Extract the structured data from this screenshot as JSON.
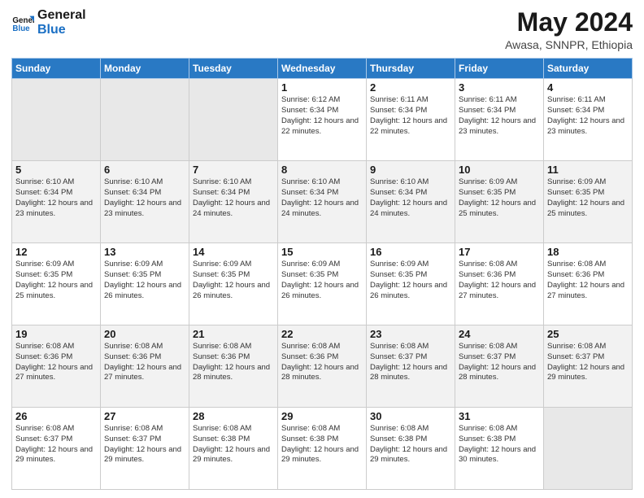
{
  "header": {
    "logo_line1": "General",
    "logo_line2": "Blue",
    "month_title": "May 2024",
    "location": "Awasa, SNNPR, Ethiopia"
  },
  "weekdays": [
    "Sunday",
    "Monday",
    "Tuesday",
    "Wednesday",
    "Thursday",
    "Friday",
    "Saturday"
  ],
  "weeks": [
    [
      {
        "day": "",
        "info": ""
      },
      {
        "day": "",
        "info": ""
      },
      {
        "day": "",
        "info": ""
      },
      {
        "day": "1",
        "info": "Sunrise: 6:12 AM\nSunset: 6:34 PM\nDaylight: 12 hours and 22 minutes."
      },
      {
        "day": "2",
        "info": "Sunrise: 6:11 AM\nSunset: 6:34 PM\nDaylight: 12 hours and 22 minutes."
      },
      {
        "day": "3",
        "info": "Sunrise: 6:11 AM\nSunset: 6:34 PM\nDaylight: 12 hours and 23 minutes."
      },
      {
        "day": "4",
        "info": "Sunrise: 6:11 AM\nSunset: 6:34 PM\nDaylight: 12 hours and 23 minutes."
      }
    ],
    [
      {
        "day": "5",
        "info": "Sunrise: 6:10 AM\nSunset: 6:34 PM\nDaylight: 12 hours and 23 minutes."
      },
      {
        "day": "6",
        "info": "Sunrise: 6:10 AM\nSunset: 6:34 PM\nDaylight: 12 hours and 23 minutes."
      },
      {
        "day": "7",
        "info": "Sunrise: 6:10 AM\nSunset: 6:34 PM\nDaylight: 12 hours and 24 minutes."
      },
      {
        "day": "8",
        "info": "Sunrise: 6:10 AM\nSunset: 6:34 PM\nDaylight: 12 hours and 24 minutes."
      },
      {
        "day": "9",
        "info": "Sunrise: 6:10 AM\nSunset: 6:34 PM\nDaylight: 12 hours and 24 minutes."
      },
      {
        "day": "10",
        "info": "Sunrise: 6:09 AM\nSunset: 6:35 PM\nDaylight: 12 hours and 25 minutes."
      },
      {
        "day": "11",
        "info": "Sunrise: 6:09 AM\nSunset: 6:35 PM\nDaylight: 12 hours and 25 minutes."
      }
    ],
    [
      {
        "day": "12",
        "info": "Sunrise: 6:09 AM\nSunset: 6:35 PM\nDaylight: 12 hours and 25 minutes."
      },
      {
        "day": "13",
        "info": "Sunrise: 6:09 AM\nSunset: 6:35 PM\nDaylight: 12 hours and 26 minutes."
      },
      {
        "day": "14",
        "info": "Sunrise: 6:09 AM\nSunset: 6:35 PM\nDaylight: 12 hours and 26 minutes."
      },
      {
        "day": "15",
        "info": "Sunrise: 6:09 AM\nSunset: 6:35 PM\nDaylight: 12 hours and 26 minutes."
      },
      {
        "day": "16",
        "info": "Sunrise: 6:09 AM\nSunset: 6:35 PM\nDaylight: 12 hours and 26 minutes."
      },
      {
        "day": "17",
        "info": "Sunrise: 6:08 AM\nSunset: 6:36 PM\nDaylight: 12 hours and 27 minutes."
      },
      {
        "day": "18",
        "info": "Sunrise: 6:08 AM\nSunset: 6:36 PM\nDaylight: 12 hours and 27 minutes."
      }
    ],
    [
      {
        "day": "19",
        "info": "Sunrise: 6:08 AM\nSunset: 6:36 PM\nDaylight: 12 hours and 27 minutes."
      },
      {
        "day": "20",
        "info": "Sunrise: 6:08 AM\nSunset: 6:36 PM\nDaylight: 12 hours and 27 minutes."
      },
      {
        "day": "21",
        "info": "Sunrise: 6:08 AM\nSunset: 6:36 PM\nDaylight: 12 hours and 28 minutes."
      },
      {
        "day": "22",
        "info": "Sunrise: 6:08 AM\nSunset: 6:36 PM\nDaylight: 12 hours and 28 minutes."
      },
      {
        "day": "23",
        "info": "Sunrise: 6:08 AM\nSunset: 6:37 PM\nDaylight: 12 hours and 28 minutes."
      },
      {
        "day": "24",
        "info": "Sunrise: 6:08 AM\nSunset: 6:37 PM\nDaylight: 12 hours and 28 minutes."
      },
      {
        "day": "25",
        "info": "Sunrise: 6:08 AM\nSunset: 6:37 PM\nDaylight: 12 hours and 29 minutes."
      }
    ],
    [
      {
        "day": "26",
        "info": "Sunrise: 6:08 AM\nSunset: 6:37 PM\nDaylight: 12 hours and 29 minutes."
      },
      {
        "day": "27",
        "info": "Sunrise: 6:08 AM\nSunset: 6:37 PM\nDaylight: 12 hours and 29 minutes."
      },
      {
        "day": "28",
        "info": "Sunrise: 6:08 AM\nSunset: 6:38 PM\nDaylight: 12 hours and 29 minutes."
      },
      {
        "day": "29",
        "info": "Sunrise: 6:08 AM\nSunset: 6:38 PM\nDaylight: 12 hours and 29 minutes."
      },
      {
        "day": "30",
        "info": "Sunrise: 6:08 AM\nSunset: 6:38 PM\nDaylight: 12 hours and 29 minutes."
      },
      {
        "day": "31",
        "info": "Sunrise: 6:08 AM\nSunset: 6:38 PM\nDaylight: 12 hours and 30 minutes."
      },
      {
        "day": "",
        "info": ""
      }
    ]
  ]
}
